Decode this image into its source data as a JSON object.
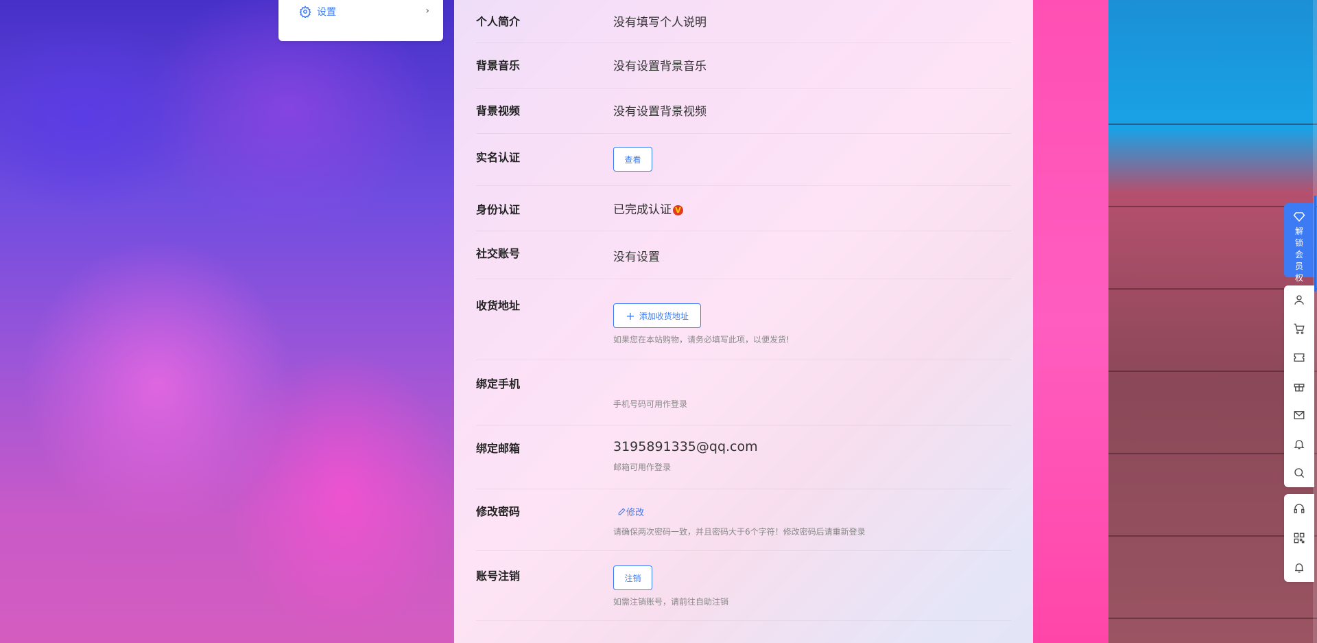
{
  "menu": {
    "settings_label": "设置",
    "arrow": "›"
  },
  "profile": {
    "bio": {
      "label": "个人简介",
      "value": "没有填写个人说明"
    },
    "bg_music": {
      "label": "背景音乐",
      "value": "没有设置背景音乐"
    },
    "bg_video": {
      "label": "背景视频",
      "value": "没有设置背景视频"
    },
    "realname": {
      "label": "实名认证",
      "button": "查看"
    },
    "identity": {
      "label": "身份认证",
      "value": "已完成认证",
      "badge": "V"
    },
    "social": {
      "label": "社交账号",
      "value": "没有设置"
    },
    "address": {
      "label": "收货地址",
      "button": "添加收货地址",
      "button_icon": "+",
      "hint": "如果您在本站购物，请务必填写此项，以便发货!"
    },
    "phone": {
      "label": "绑定手机",
      "hint": "手机号码可用作登录"
    },
    "email": {
      "label": "绑定邮箱",
      "value": "3195891335@qq.com",
      "hint": "邮箱可用作登录"
    },
    "password": {
      "label": "修改密码",
      "link": "修改",
      "hint": "请确保两次密码一致，并且密码大于6个字符！修改密码后请重新登录"
    },
    "cancel": {
      "label": "账号注销",
      "button": "注销",
      "hint": "如需注销账号，请前往自助注销"
    }
  },
  "sidebar": {
    "vip_label": "解锁会员权限",
    "tools": [
      "user-icon",
      "cart-icon",
      "ticket-icon",
      "gift-icon",
      "mail-icon",
      "bell-icon",
      "search-icon"
    ],
    "tools2": [
      "headset-icon",
      "qrcode-icon",
      "alarm-icon"
    ]
  },
  "colors": {
    "accent": "#3d7bf5",
    "badge": "#e23b1e"
  }
}
